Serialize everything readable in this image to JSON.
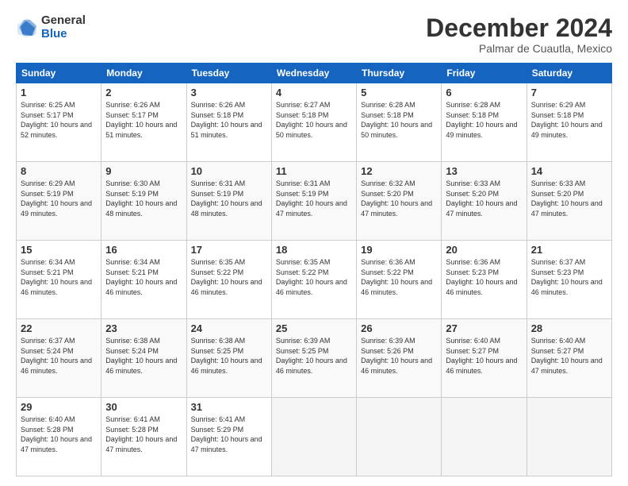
{
  "logo": {
    "general": "General",
    "blue": "Blue"
  },
  "title": "December 2024",
  "location": "Palmar de Cuautla, Mexico",
  "headers": [
    "Sunday",
    "Monday",
    "Tuesday",
    "Wednesday",
    "Thursday",
    "Friday",
    "Saturday"
  ],
  "weeks": [
    [
      {
        "day": "1",
        "sunrise": "6:25 AM",
        "sunset": "5:17 PM",
        "daylight": "10 hours and 52 minutes."
      },
      {
        "day": "2",
        "sunrise": "6:26 AM",
        "sunset": "5:17 PM",
        "daylight": "10 hours and 51 minutes."
      },
      {
        "day": "3",
        "sunrise": "6:26 AM",
        "sunset": "5:18 PM",
        "daylight": "10 hours and 51 minutes."
      },
      {
        "day": "4",
        "sunrise": "6:27 AM",
        "sunset": "5:18 PM",
        "daylight": "10 hours and 50 minutes."
      },
      {
        "day": "5",
        "sunrise": "6:28 AM",
        "sunset": "5:18 PM",
        "daylight": "10 hours and 50 minutes."
      },
      {
        "day": "6",
        "sunrise": "6:28 AM",
        "sunset": "5:18 PM",
        "daylight": "10 hours and 49 minutes."
      },
      {
        "day": "7",
        "sunrise": "6:29 AM",
        "sunset": "5:18 PM",
        "daylight": "10 hours and 49 minutes."
      }
    ],
    [
      {
        "day": "8",
        "sunrise": "6:29 AM",
        "sunset": "5:19 PM",
        "daylight": "10 hours and 49 minutes."
      },
      {
        "day": "9",
        "sunrise": "6:30 AM",
        "sunset": "5:19 PM",
        "daylight": "10 hours and 48 minutes."
      },
      {
        "day": "10",
        "sunrise": "6:31 AM",
        "sunset": "5:19 PM",
        "daylight": "10 hours and 48 minutes."
      },
      {
        "day": "11",
        "sunrise": "6:31 AM",
        "sunset": "5:19 PM",
        "daylight": "10 hours and 47 minutes."
      },
      {
        "day": "12",
        "sunrise": "6:32 AM",
        "sunset": "5:20 PM",
        "daylight": "10 hours and 47 minutes."
      },
      {
        "day": "13",
        "sunrise": "6:33 AM",
        "sunset": "5:20 PM",
        "daylight": "10 hours and 47 minutes."
      },
      {
        "day": "14",
        "sunrise": "6:33 AM",
        "sunset": "5:20 PM",
        "daylight": "10 hours and 47 minutes."
      }
    ],
    [
      {
        "day": "15",
        "sunrise": "6:34 AM",
        "sunset": "5:21 PM",
        "daylight": "10 hours and 46 minutes."
      },
      {
        "day": "16",
        "sunrise": "6:34 AM",
        "sunset": "5:21 PM",
        "daylight": "10 hours and 46 minutes."
      },
      {
        "day": "17",
        "sunrise": "6:35 AM",
        "sunset": "5:22 PM",
        "daylight": "10 hours and 46 minutes."
      },
      {
        "day": "18",
        "sunrise": "6:35 AM",
        "sunset": "5:22 PM",
        "daylight": "10 hours and 46 minutes."
      },
      {
        "day": "19",
        "sunrise": "6:36 AM",
        "sunset": "5:22 PM",
        "daylight": "10 hours and 46 minutes."
      },
      {
        "day": "20",
        "sunrise": "6:36 AM",
        "sunset": "5:23 PM",
        "daylight": "10 hours and 46 minutes."
      },
      {
        "day": "21",
        "sunrise": "6:37 AM",
        "sunset": "5:23 PM",
        "daylight": "10 hours and 46 minutes."
      }
    ],
    [
      {
        "day": "22",
        "sunrise": "6:37 AM",
        "sunset": "5:24 PM",
        "daylight": "10 hours and 46 minutes."
      },
      {
        "day": "23",
        "sunrise": "6:38 AM",
        "sunset": "5:24 PM",
        "daylight": "10 hours and 46 minutes."
      },
      {
        "day": "24",
        "sunrise": "6:38 AM",
        "sunset": "5:25 PM",
        "daylight": "10 hours and 46 minutes."
      },
      {
        "day": "25",
        "sunrise": "6:39 AM",
        "sunset": "5:25 PM",
        "daylight": "10 hours and 46 minutes."
      },
      {
        "day": "26",
        "sunrise": "6:39 AM",
        "sunset": "5:26 PM",
        "daylight": "10 hours and 46 minutes."
      },
      {
        "day": "27",
        "sunrise": "6:40 AM",
        "sunset": "5:27 PM",
        "daylight": "10 hours and 46 minutes."
      },
      {
        "day": "28",
        "sunrise": "6:40 AM",
        "sunset": "5:27 PM",
        "daylight": "10 hours and 47 minutes."
      }
    ],
    [
      {
        "day": "29",
        "sunrise": "6:40 AM",
        "sunset": "5:28 PM",
        "daylight": "10 hours and 47 minutes."
      },
      {
        "day": "30",
        "sunrise": "6:41 AM",
        "sunset": "5:28 PM",
        "daylight": "10 hours and 47 minutes."
      },
      {
        "day": "31",
        "sunrise": "6:41 AM",
        "sunset": "5:29 PM",
        "daylight": "10 hours and 47 minutes."
      },
      null,
      null,
      null,
      null
    ]
  ]
}
